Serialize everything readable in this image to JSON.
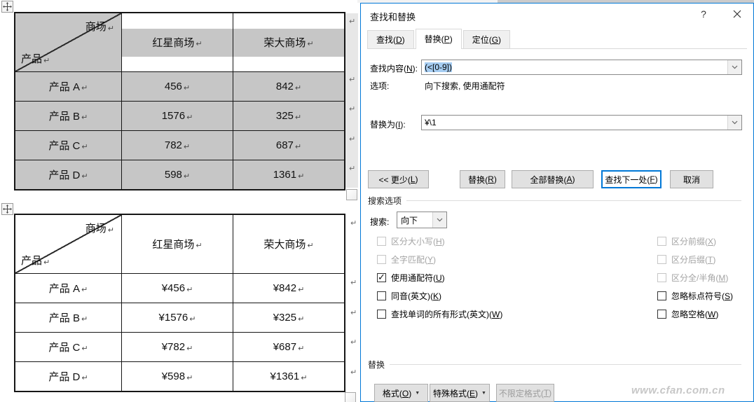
{
  "colors": {
    "accent": "#0078d7",
    "table_shade": "#c6c6c6",
    "selection_highlight": "#a6cdf2",
    "button_face": "#e1e1e1"
  },
  "document": {
    "paragraph_mark": "↵",
    "tables": [
      {
        "corner_top": "商场",
        "corner_bottom": "产品",
        "columns": [
          "红星商场",
          "荣大商场"
        ],
        "rows": [
          [
            "产品 A",
            "456",
            "842"
          ],
          [
            "产品 B",
            "1576",
            "325"
          ],
          [
            "产品 C",
            "782",
            "687"
          ],
          [
            "产品 D",
            "598",
            "1361"
          ]
        ]
      },
      {
        "corner_top": "商场",
        "corner_bottom": "产品",
        "columns": [
          "红星商场",
          "荣大商场"
        ],
        "rows": [
          [
            "产品 A",
            "¥456",
            "¥842"
          ],
          [
            "产品 B",
            "¥1576",
            "¥325"
          ],
          [
            "产品 C",
            "¥782",
            "¥687"
          ],
          [
            "产品 D",
            "¥598",
            "¥1361"
          ]
        ]
      }
    ]
  },
  "dialog": {
    "title": "查找和替换",
    "help_button": "?",
    "tabs": [
      {
        "label": "查找(D)"
      },
      {
        "label": "替换(P)"
      },
      {
        "label": "定位(G)"
      }
    ],
    "find_label": "查找内容(N):",
    "find_value": "(<[0-9])",
    "options_label": "选项:",
    "options_value": "向下搜索, 使用通配符",
    "replace_label": "替换为(I):",
    "replace_value": "¥\\1",
    "buttons": {
      "less": "<< 更少(L)",
      "replace": "替换(R)",
      "replace_all": "全部替换(A)",
      "find_next": "查找下一处(F)",
      "cancel": "取消"
    },
    "search_options": {
      "group_label": "搜索选项",
      "search_label": "搜索:",
      "search_value": "向下",
      "left": [
        {
          "label": "区分大小写(H)",
          "state": "disabled"
        },
        {
          "label": "全字匹配(Y)",
          "state": "disabled"
        },
        {
          "label": "使用通配符(U)",
          "state": "checked"
        },
        {
          "label": "同音(英文)(K)",
          "state": "unchecked"
        },
        {
          "label": "查找单词的所有形式(英文)(W)",
          "state": "unchecked"
        }
      ],
      "right": [
        {
          "label": "区分前缀(X)",
          "state": "disabled"
        },
        {
          "label": "区分后缀(T)",
          "state": "disabled"
        },
        {
          "label": "区分全/半角(M)",
          "state": "disabled"
        },
        {
          "label": "忽略标点符号(S)",
          "state": "unchecked"
        },
        {
          "label": "忽略空格(W)",
          "state": "unchecked"
        }
      ]
    },
    "replace_group": {
      "group_label": "替换",
      "format_button": "格式(O)",
      "special_button": "特殊格式(E)",
      "no_format_button": "不限定格式(T)"
    }
  },
  "watermark": "www.cfan.com.cn"
}
